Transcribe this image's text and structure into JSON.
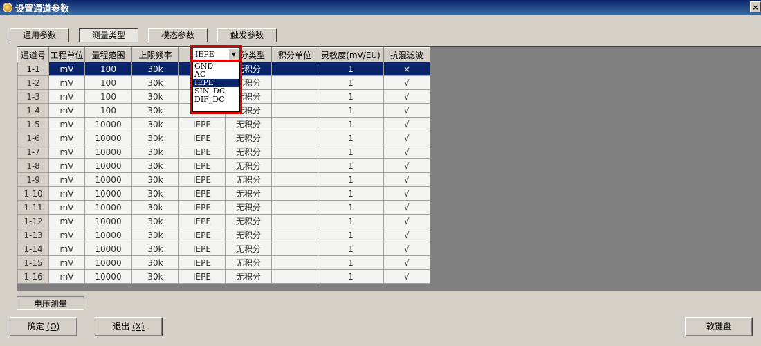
{
  "window": {
    "title": "设置通道参数",
    "close_glyph": "×"
  },
  "tabs": [
    {
      "label": "通用参数",
      "active": false
    },
    {
      "label": "测量类型",
      "active": true
    },
    {
      "label": "模态参数",
      "active": false
    },
    {
      "label": "触发参数",
      "active": false
    }
  ],
  "grid": {
    "columns": [
      "通道号",
      "工程单位",
      "量程范围",
      "上限频率",
      "IEPE",
      "积分类型",
      "积分单位",
      "灵敏度(mV/EU)",
      "抗混滤波"
    ],
    "rows": [
      [
        "1-1",
        "mV",
        "100",
        "30k",
        "",
        "无积分",
        "",
        "1",
        "×"
      ],
      [
        "1-2",
        "mV",
        "100",
        "30k",
        "",
        "无积分",
        "",
        "1",
        "√"
      ],
      [
        "1-3",
        "mV",
        "100",
        "30k",
        "",
        "无积分",
        "",
        "1",
        "√"
      ],
      [
        "1-4",
        "mV",
        "100",
        "30k",
        "",
        "无积分",
        "",
        "1",
        "√"
      ],
      [
        "1-5",
        "mV",
        "10000",
        "30k",
        "IEPE",
        "无积分",
        "",
        "1",
        "√"
      ],
      [
        "1-6",
        "mV",
        "10000",
        "30k",
        "IEPE",
        "无积分",
        "",
        "1",
        "√"
      ],
      [
        "1-7",
        "mV",
        "10000",
        "30k",
        "IEPE",
        "无积分",
        "",
        "1",
        "√"
      ],
      [
        "1-8",
        "mV",
        "10000",
        "30k",
        "IEPE",
        "无积分",
        "",
        "1",
        "√"
      ],
      [
        "1-9",
        "mV",
        "10000",
        "30k",
        "IEPE",
        "无积分",
        "",
        "1",
        "√"
      ],
      [
        "1-10",
        "mV",
        "10000",
        "30k",
        "IEPE",
        "无积分",
        "",
        "1",
        "√"
      ],
      [
        "1-11",
        "mV",
        "10000",
        "30k",
        "IEPE",
        "无积分",
        "",
        "1",
        "√"
      ],
      [
        "1-12",
        "mV",
        "10000",
        "30k",
        "IEPE",
        "无积分",
        "",
        "1",
        "√"
      ],
      [
        "1-13",
        "mV",
        "10000",
        "30k",
        "IEPE",
        "无积分",
        "",
        "1",
        "√"
      ],
      [
        "1-14",
        "mV",
        "10000",
        "30k",
        "IEPE",
        "无积分",
        "",
        "1",
        "√"
      ],
      [
        "1-15",
        "mV",
        "10000",
        "30k",
        "IEPE",
        "无积分",
        "",
        "1",
        "√"
      ],
      [
        "1-16",
        "mV",
        "10000",
        "30k",
        "IEPE",
        "无积分",
        "",
        "1",
        "√"
      ]
    ],
    "selected_row": 0
  },
  "type_dropdown": {
    "value": "IEPE",
    "options": [
      "GND",
      "AC",
      "IEPE",
      "SIN_DC",
      "DIF_DC"
    ],
    "highlighted": "IEPE"
  },
  "status_label": "电压测量",
  "buttons": {
    "ok_label": "确定",
    "ok_shortcut": "(O)",
    "exit_label": "退出",
    "exit_shortcut": "(X)",
    "keyboard_label": "软键盘"
  },
  "colors": {
    "title_bar": "#0a246a",
    "selection": "#0a246a",
    "highlight_box": "#e00000",
    "empty_area": "#808080"
  }
}
